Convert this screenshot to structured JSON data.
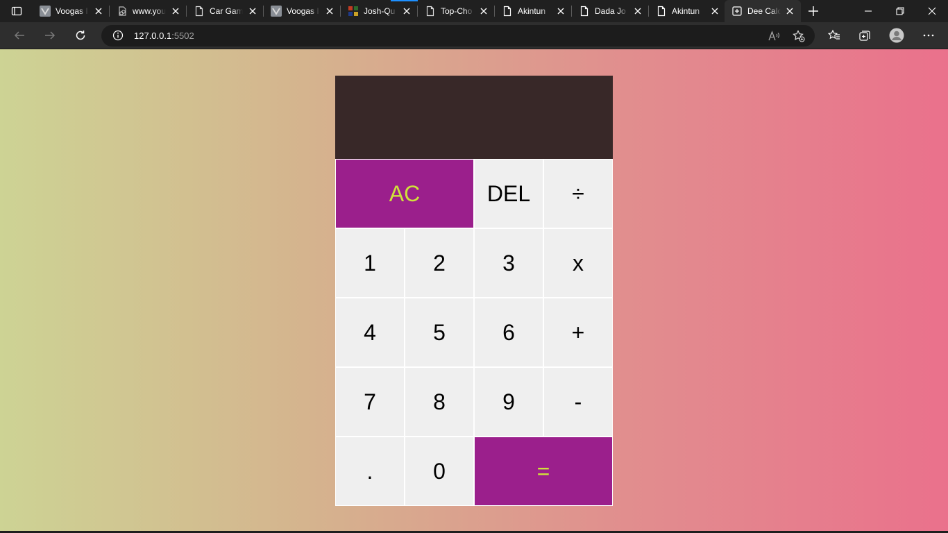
{
  "browser": {
    "tabs": [
      {
        "title": "Voogas I",
        "icon": "voogas-favicon",
        "active": false
      },
      {
        "title": "www.you",
        "icon": "link-favicon",
        "active": false
      },
      {
        "title": "Car Gam",
        "icon": "page-icon",
        "active": false
      },
      {
        "title": "Voogas I",
        "icon": "voogas-favicon",
        "active": false
      },
      {
        "title": "Josh-Qu",
        "icon": "multicolor-favicon",
        "active": false
      },
      {
        "title": "Top-Cho",
        "icon": "page-icon",
        "active": false
      },
      {
        "title": "Akintun",
        "icon": "page-icon",
        "active": false
      },
      {
        "title": "Dada Jo",
        "icon": "page-icon",
        "active": false
      },
      {
        "title": "Akintun",
        "icon": "page-icon",
        "active": false
      },
      {
        "title": "Dee Calc",
        "icon": "page-icon",
        "active": true
      }
    ],
    "address": {
      "host": "127.0.0.1",
      "port": ":5502"
    }
  },
  "calculator": {
    "previous_operand": "",
    "current_operand": "",
    "keys": {
      "ac": "AC",
      "del": "DEL",
      "divide": "÷",
      "one": "1",
      "two": "2",
      "three": "3",
      "multiply": "x",
      "four": "4",
      "five": "5",
      "six": "6",
      "add": "+",
      "seven": "7",
      "eight": "8",
      "nine": "9",
      "subtract": "-",
      "decimal": ".",
      "zero": "0",
      "equals": "="
    }
  },
  "colors": {
    "accent_key_bg": "#9b1f8c",
    "accent_key_text": "#cfe23a",
    "display_bg": "#382828",
    "key_bg": "#efefef",
    "gradient": [
      "#cdd394",
      "#d5b38e",
      "#e18e8e",
      "#ea718c"
    ]
  }
}
